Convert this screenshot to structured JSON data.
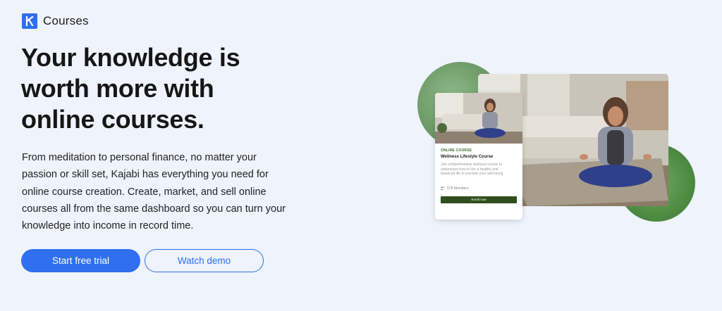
{
  "brand": {
    "name": "Courses"
  },
  "hero": {
    "headline_lines": [
      "Your knowledge is",
      "worth more with",
      "online courses."
    ],
    "body_lines": [
      "From meditation to personal finance, no matter your",
      "passion or skill set, Kajabi has everything you need for",
      "online course creation. Create, market, and sell online",
      "courses all from the same dashboard so you can turn your",
      "knowledge into income in record time."
    ],
    "primary_cta": "Start free trial",
    "secondary_cta": "Watch demo"
  },
  "course_card": {
    "kicker": "ONLINE COURSE",
    "title": "Wellness Lifestyle Course",
    "description": "Join comprehensive wellness course to understand how to live a healthy and balanced life to promote your well-being",
    "members": "578 Members",
    "enroll_label": "Enroll now"
  },
  "colors": {
    "accent": "#2f6ff0",
    "background": "#eef3fc",
    "card_button": "#2f4f1e"
  },
  "icons": {
    "brand": "kajabi-k-icon",
    "members": "members-icon"
  }
}
